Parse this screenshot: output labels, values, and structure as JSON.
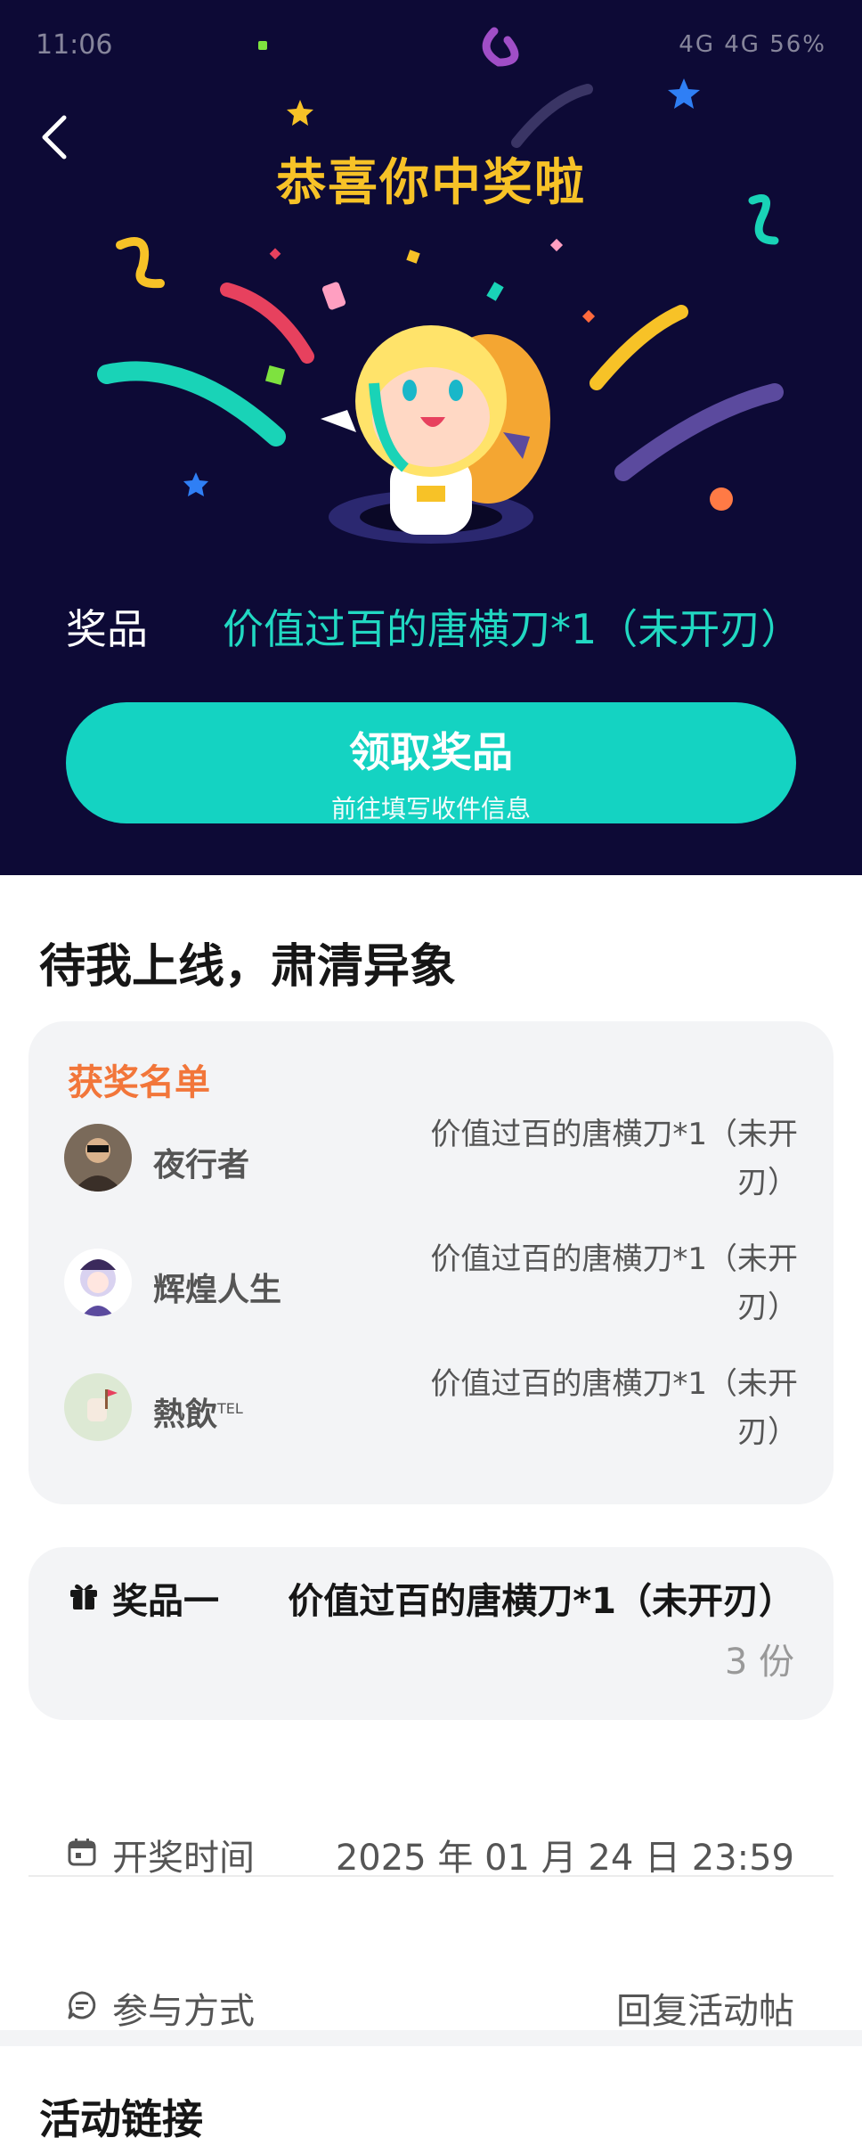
{
  "status_bar": {
    "time": "11:06",
    "indicators": "4G 4G 56%"
  },
  "header": {
    "back_icon": "back-arrow-icon",
    "title": "恭喜你中奖啦"
  },
  "prize": {
    "label": "奖品",
    "value": "价值过百的唐横刀*1（未开刃）"
  },
  "claim_button": {
    "title": "领取奖品",
    "subtitle": "前往填写收件信息"
  },
  "event": {
    "title": "待我上线，肃清异象"
  },
  "winners": {
    "title": "获奖名单",
    "items": [
      {
        "name": "夜行者",
        "prize_line1": "价值过百的唐横刀*1（未开",
        "prize_line2": "刃）"
      },
      {
        "name": "辉煌人生",
        "prize_line1": "价值过百的唐横刀*1（未开",
        "prize_line2": "刃）"
      },
      {
        "name": "熱飲",
        "name_sup": "TEL",
        "prize_line1": "价值过百的唐横刀*1（未开",
        "prize_line2": "刃）"
      }
    ]
  },
  "prize_item": {
    "label": "奖品一",
    "value": "价值过百的唐横刀*1（未开刃）",
    "count": "3 份"
  },
  "draw_time": {
    "label": "开奖时间",
    "value": "2025 年 01 月 24 日 23:59"
  },
  "participation": {
    "label": "参与方式",
    "value": "回复活动帖"
  },
  "links": {
    "title": "活动链接"
  },
  "colors": {
    "hero_bg": "#0d0a36",
    "accent": "#14d3c2",
    "title_gold": "#f7c227",
    "winners_title": "#f2763a"
  }
}
